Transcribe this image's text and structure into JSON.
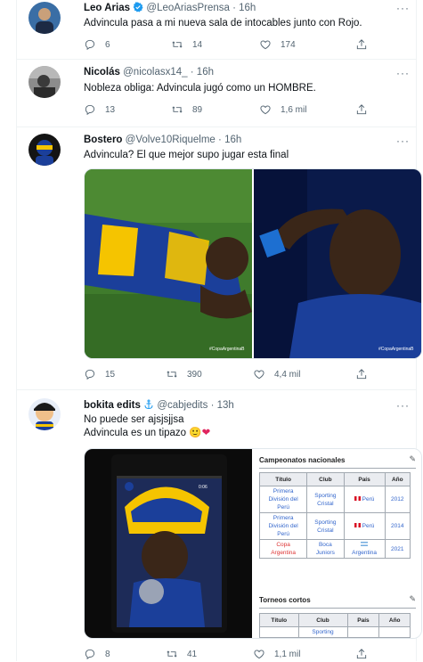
{
  "tweets": [
    {
      "name": "Leo Arias",
      "handle": "@LeoAriasPrensa",
      "time": "16h",
      "verified": true,
      "text_lines": [
        "Advincula pasa a mi nueva sala de intocables junto con Rojo."
      ],
      "replies": "6",
      "retweets": "14",
      "likes": "174"
    },
    {
      "name": "Nicolás",
      "handle": "@nicolasx14_",
      "time": "16h",
      "text_lines": [
        "Nobleza obliga: Advincula jugó como un HOMBRE."
      ],
      "replies": "13",
      "retweets": "89",
      "likes": "1,6 mil"
    },
    {
      "name": "Bostero",
      "handle": "@Volve10Riquelme",
      "time": "16h",
      "text_lines": [
        "Advincula? El que mejor supo jugar esta final"
      ],
      "media_watermark": "#CopaArgentinaB",
      "replies": "15",
      "retweets": "390",
      "likes": "4,4 mil"
    },
    {
      "name": "bokita edits",
      "handle": "@cabjedits",
      "time": "13h",
      "text_lines": [
        "No puede ser ajsjsjjsa",
        "Advincula es un tipazo"
      ],
      "emoji": "🙂❤",
      "video_time": "0:06",
      "replies": "8",
      "retweets": "41",
      "likes": "1,1 mil"
    }
  ],
  "wiki": {
    "section1": "Campeonatos nacionales",
    "headers": [
      "Título",
      "Club",
      "País",
      "Año"
    ],
    "rows": [
      {
        "titulo": [
          "Primera",
          "División del",
          "Perú"
        ],
        "club": [
          "Sporting",
          "Cristal"
        ],
        "pais": "Perú",
        "anio": "2012"
      },
      {
        "titulo": [
          "Primera",
          "División del",
          "Perú"
        ],
        "club": [
          "Sporting",
          "Cristal"
        ],
        "pais": "Perú",
        "anio": "2014"
      },
      {
        "titulo": [
          "Copa",
          "Argentina"
        ],
        "club": [
          "Boca",
          "Juniors"
        ],
        "pais": "Argentina",
        "anio": "2021"
      }
    ],
    "section2": "Torneos cortos",
    "headers2": [
      "Título",
      "Club",
      "País",
      "Año"
    ],
    "partial_cell": "Sporting"
  },
  "colors": {
    "text": "#0f1419",
    "secondary": "#536471",
    "verified": "#1d9bf0",
    "border": "#eff3f4",
    "boca_blue": "#1b3f9a",
    "boca_yellow": "#f5c400"
  }
}
